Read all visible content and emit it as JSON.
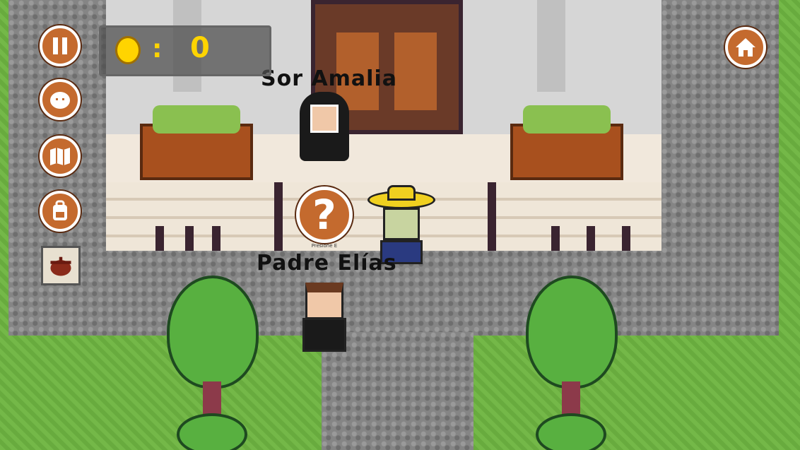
{
  "hud": {
    "coin_separator": ":",
    "coin_count": "0"
  },
  "npcs": {
    "nun_name": "Sor Amalia",
    "priest_name": "Padre Elías"
  },
  "help": {
    "symbol": "?",
    "caption": "Presione E"
  },
  "icons": {
    "pause": "pause-icon",
    "character": "character-face-icon",
    "map": "map-icon",
    "backpack": "backpack-icon",
    "pot": "cooking-pot-icon",
    "home": "home-icon",
    "coin": "coin-icon"
  },
  "colors": {
    "button_orange": "#c46a2e",
    "coin_gold": "#ffd400",
    "grass": "#74b848",
    "stone": "#858585"
  }
}
